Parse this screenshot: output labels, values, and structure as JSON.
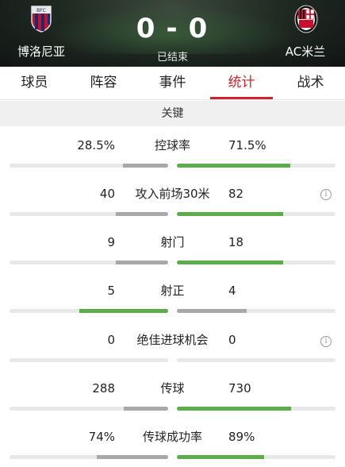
{
  "match": {
    "home_team": "博洛尼亚",
    "away_team": "AC米兰",
    "home_score": "0",
    "score_separator": "-",
    "away_score": "0",
    "status": "已结束",
    "home_crest": "bologna-crest-icon",
    "away_crest": "ac-milan-crest-icon"
  },
  "tabs": [
    {
      "label": "球员",
      "active": false
    },
    {
      "label": "阵容",
      "active": false
    },
    {
      "label": "事件",
      "active": false
    },
    {
      "label": "统计",
      "active": true
    },
    {
      "label": "战术",
      "active": false
    }
  ],
  "section": {
    "title": "关键"
  },
  "colors": {
    "accent": "#d0222d",
    "winner_bar": "#5aad48",
    "loser_bar": "#a8a8a8",
    "track": "#e8e8e8"
  },
  "stats": [
    {
      "label": "控球率",
      "home": "28.5%",
      "away": "71.5%",
      "home_fill": 0.285,
      "away_fill": 0.715,
      "winner": "away",
      "info": false
    },
    {
      "label": "攻入前场30米",
      "home": "40",
      "away": "82",
      "home_fill": 0.33,
      "away_fill": 0.67,
      "winner": "away",
      "info": true
    },
    {
      "label": "射门",
      "home": "9",
      "away": "18",
      "home_fill": 0.33,
      "away_fill": 0.67,
      "winner": "away",
      "info": false
    },
    {
      "label": "射正",
      "home": "5",
      "away": "4",
      "home_fill": 0.56,
      "away_fill": 0.44,
      "winner": "home",
      "info": false
    },
    {
      "label": "绝佳进球机会",
      "home": "0",
      "away": "0",
      "home_fill": 0,
      "away_fill": 0,
      "winner": "none",
      "info": true
    },
    {
      "label": "传球",
      "home": "288",
      "away": "730",
      "home_fill": 0.28,
      "away_fill": 0.72,
      "winner": "away",
      "info": false
    },
    {
      "label": "传球成功率",
      "home": "74%",
      "away": "89%",
      "home_fill": 0.45,
      "away_fill": 0.55,
      "winner": "away",
      "info": false
    }
  ]
}
